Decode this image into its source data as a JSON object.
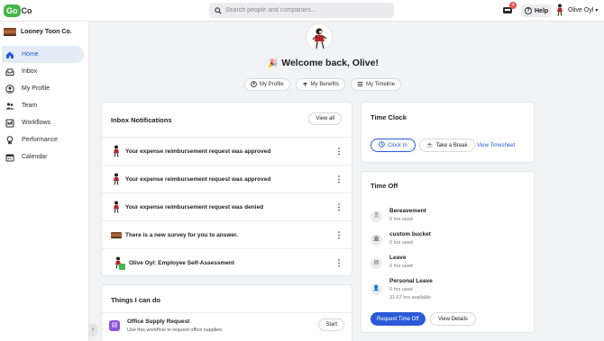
{
  "header": {
    "logo_go": "Go",
    "logo_co": "Co",
    "search_placeholder": "Search people and companies...",
    "inbox_badge": "4",
    "help_label": "Help",
    "user_name": "Olive Oyl"
  },
  "sidebar": {
    "company_name": "Looney Toon Co.",
    "items": [
      {
        "label": "Home",
        "icon": "home-icon",
        "active": true
      },
      {
        "label": "Inbox",
        "icon": "inbox-icon"
      },
      {
        "label": "My Profile",
        "icon": "profile-icon"
      },
      {
        "label": "Team",
        "icon": "team-icon"
      },
      {
        "label": "Workflows",
        "icon": "workflows-icon"
      },
      {
        "label": "Performance",
        "icon": "performance-icon"
      },
      {
        "label": "Calendar",
        "icon": "calendar-icon"
      }
    ]
  },
  "welcome": {
    "emoji": "🎉",
    "text": "Welcome back, Olive!",
    "pills": [
      {
        "label": "My Profile",
        "icon": "profile-icon"
      },
      {
        "label": "My Benefits",
        "icon": "umbrella-icon"
      },
      {
        "label": "My Timeline",
        "icon": "timeline-icon"
      }
    ]
  },
  "inbox": {
    "title": "Inbox Notifications",
    "view_all": "View all",
    "items": [
      {
        "text": "Your expense reimbursement request was approved"
      },
      {
        "text": "Your expense reimbursement request was approved"
      },
      {
        "text": "Your expense reimbursement request was denied"
      },
      {
        "text": "There is a new survey for you to answer."
      },
      {
        "text": "Olive Oyl: Employee Self-Assessment"
      }
    ]
  },
  "things": {
    "title": "Things I can do",
    "workflow": {
      "title": "Office Supply Request",
      "desc": "Use this workflow to request office supplies.",
      "start": "Start"
    }
  },
  "time_clock": {
    "title": "Time Clock",
    "clock_in": "Clock In",
    "take_break": "Take a Break",
    "view_timesheet": "View Timesheet"
  },
  "time_off": {
    "title": "Time Off",
    "items": [
      {
        "name": "Bereavement",
        "used": "0 hrs used"
      },
      {
        "name": "custom bucket",
        "used": "0 hrs used"
      },
      {
        "name": "Leave",
        "used": "0 hrs used"
      },
      {
        "name": "Personal Leave",
        "used": "0 hrs used",
        "available": "31.67 hrs available"
      }
    ],
    "request_btn": "Request Time Off",
    "details_btn": "View Details"
  },
  "colors": {
    "accent": "#2a5bd7",
    "brand_green": "#43b649",
    "badge": "#e8554e"
  }
}
